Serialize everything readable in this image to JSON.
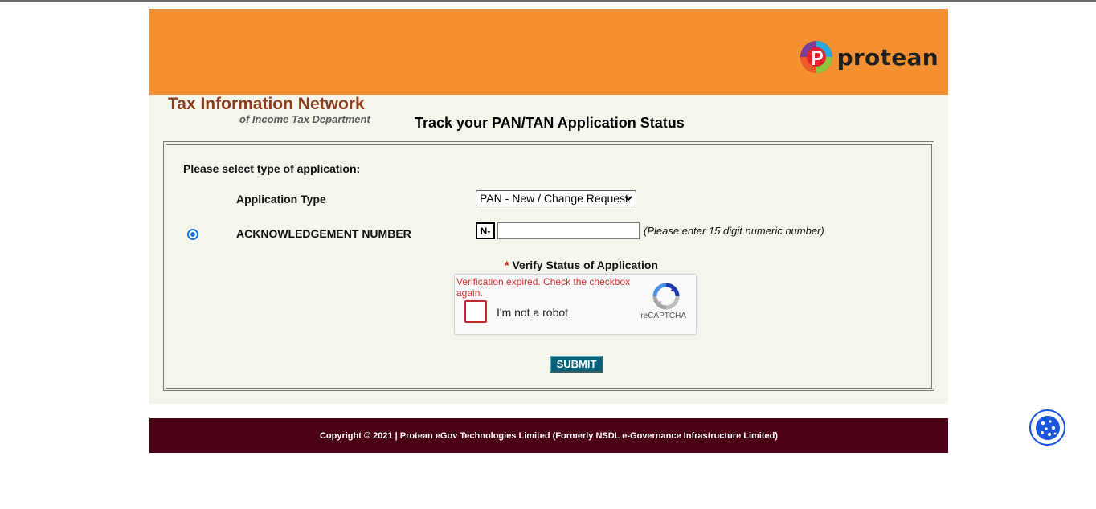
{
  "header": {
    "logo_text": "protean"
  },
  "branding": {
    "title": "Tax Information Network",
    "subtitle": "of Income Tax Department"
  },
  "page": {
    "title": "Track your PAN/TAN Application Status"
  },
  "form": {
    "select_prompt": "Please select type of application:",
    "application_type_label": "Application Type",
    "application_type_value": "PAN - New / Change Request",
    "ack_label": "ACKNOWLEDGEMENT NUMBER",
    "ack_prefix": "N-",
    "ack_value": "",
    "ack_hint": "(Please enter 15 digit numeric number)",
    "verify_star": "*",
    "verify_label": "Verify Status of Application",
    "submit_label": "SUBMIT"
  },
  "captcha": {
    "error": "Verification expired. Check the checkbox again.",
    "label": "I'm not a robot",
    "brand": "reCAPTCHA"
  },
  "footer": {
    "copyright": "Copyright © 2021 | Protean eGov Technologies Limited (Formerly NSDL e-Governance Infrastructure Limited)"
  },
  "colors": {
    "header_bg": "#f4902f",
    "panel_bg": "#f6f5ec",
    "footer_bg": "#4a0015",
    "brand_title": "#8a3c1e",
    "submit_bg": "#03627a"
  },
  "icons": {
    "logo": "protean-logo-icon",
    "dropdown": "chevron-down-icon",
    "captcha": "recaptcha-icon",
    "cookie": "cookie-icon"
  }
}
